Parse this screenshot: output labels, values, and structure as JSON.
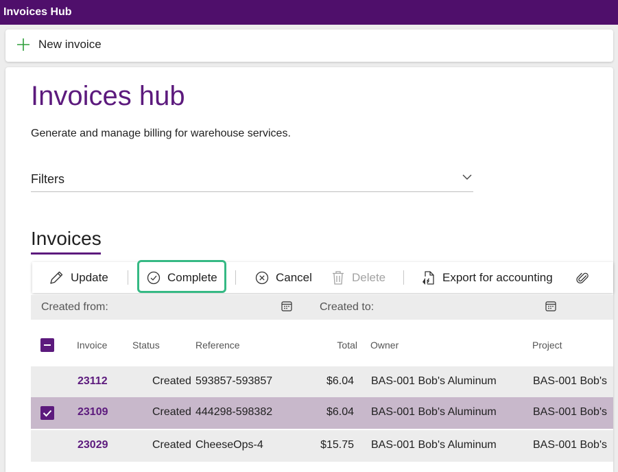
{
  "app": {
    "title": "Invoices Hub"
  },
  "command_bar": {
    "new_invoice_label": "New invoice"
  },
  "page": {
    "title": "Invoices hub",
    "description": "Generate and manage billing for warehouse services.",
    "filters_label": "Filters",
    "section_title": "Invoices"
  },
  "toolbar": {
    "update": "Update",
    "complete": "Complete",
    "cancel": "Cancel",
    "delete": "Delete",
    "export": "Export for accounting"
  },
  "date_filter": {
    "from_label": "Created from:",
    "to_label": "Created to:"
  },
  "table": {
    "columns": {
      "invoice": "Invoice",
      "status": "Status",
      "reference": "Reference",
      "total": "Total",
      "owner": "Owner",
      "project": "Project"
    },
    "rows": [
      {
        "invoice": "23112",
        "status": "Created",
        "reference": "593857-593857",
        "total": "$6.04",
        "owner": "BAS-001 Bob's Aluminum",
        "project": "BAS-001 Bob's",
        "selected": false
      },
      {
        "invoice": "23109",
        "status": "Created",
        "reference": "444298-598382",
        "total": "$6.04",
        "owner": "BAS-001 Bob's Aluminum",
        "project": "BAS-001 Bob's",
        "selected": true
      },
      {
        "invoice": "23029",
        "status": "Created",
        "reference": "CheeseOps-4",
        "total": "$15.75",
        "owner": "BAS-001 Bob's Aluminum",
        "project": "BAS-001 Bob's",
        "selected": false
      }
    ]
  },
  "colors": {
    "brand": "#4f0f6b",
    "accent": "#5c1a7d",
    "focus": "#35b984",
    "selected_row": "#c8b8cb",
    "add_icon": "#2e9e3a"
  },
  "icons": {
    "new": "plus-icon",
    "update": "pencil-icon",
    "complete": "check-circle-icon",
    "cancel": "cancel-circle-icon",
    "delete": "trash-icon",
    "export": "export-document-icon",
    "attach": "paperclip-icon",
    "calendar": "calendar-icon",
    "filters": "chevron-down-icon"
  }
}
